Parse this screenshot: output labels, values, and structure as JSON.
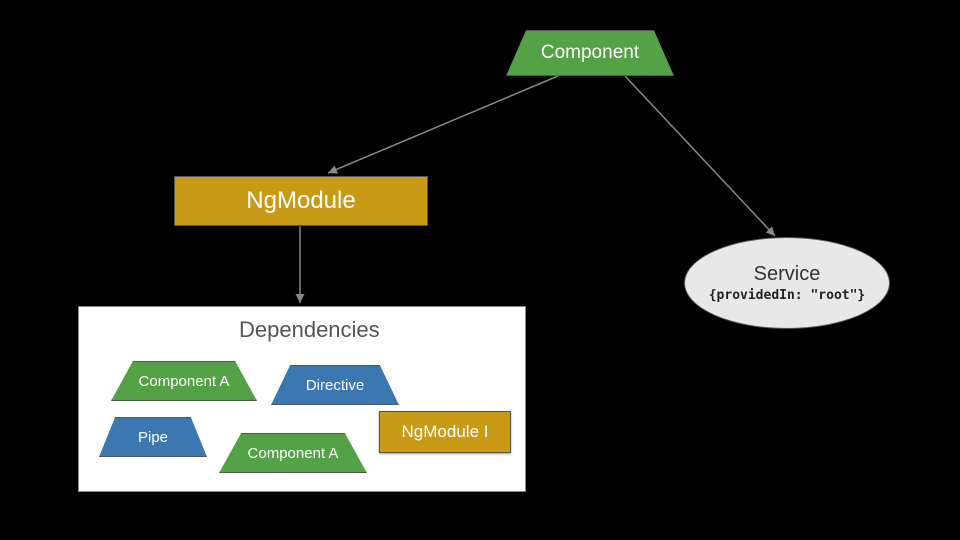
{
  "root": {
    "component_label": "Component",
    "ngmodule_label": "NgModule",
    "service": {
      "title": "Service",
      "subtitle": "{providedIn: \"root\"}"
    }
  },
  "dependencies": {
    "title": "Dependencies",
    "items": {
      "component_a1": "Component A",
      "directive": "Directive",
      "pipe": "Pipe",
      "component_a2": "Component A",
      "ngmodule_i": "NgModule I"
    }
  },
  "colors": {
    "green": "#53a245",
    "blue": "#3b78b2",
    "gold": "#c99a15",
    "ellipse_fill": "#e8e8e8"
  }
}
